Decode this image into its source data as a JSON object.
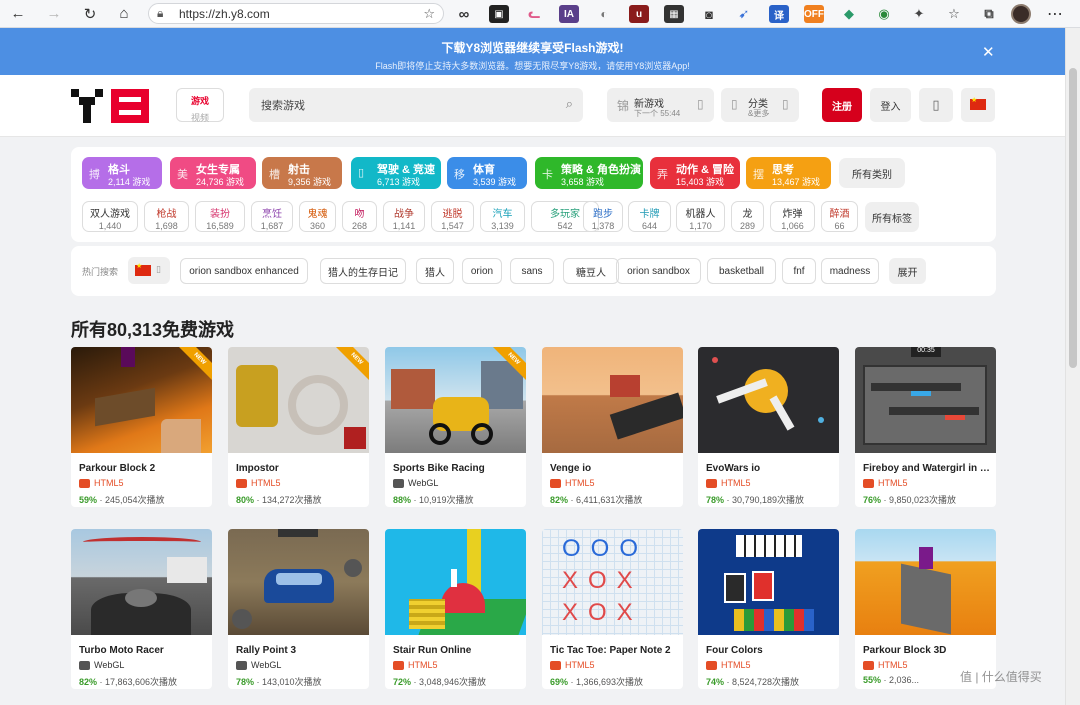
{
  "browser": {
    "url": "https://zh.y8.com"
  },
  "banner": {
    "title": "下载Y8浏览器继续享受Flash游戏!",
    "subtitle": "Flash即将停止支持大多数浏览器。想要无限尽享Y8游戏，请使用Y8浏览器App!"
  },
  "header": {
    "tab_games": "游戏",
    "tab_videos": "视频",
    "search_placeholder": "搜索游戏",
    "new_games": "新游戏",
    "new_games_sub": "下一个 55:44",
    "categories": "分类",
    "categories_sub": "&更多",
    "register": "注册",
    "login": "登入"
  },
  "categories": [
    {
      "name": "格斗",
      "count": "2,114 游戏",
      "icon": "搏",
      "color": "#b56ee8"
    },
    {
      "name": "女生专属",
      "count": "24,736 游戏",
      "icon": "美",
      "color": "#f04b84"
    },
    {
      "name": "射击",
      "count": "9,356 游戏",
      "icon": "槽",
      "color": "#c8784a"
    },
    {
      "name": "驾驶 & 竞速",
      "count": "6,713 游戏",
      "icon": "▯",
      "color": "#12b8c8"
    },
    {
      "name": "体育",
      "count": "3,539 游戏",
      "icon": "移",
      "color": "#3b8de8"
    },
    {
      "name": "策略 & 角色扮演",
      "count": "3,658 游戏",
      "icon": "卡",
      "color": "#2fb82a"
    },
    {
      "name": "动作 & 冒险",
      "count": "15,403 游戏",
      "icon": "弄",
      "color": "#e8303c"
    },
    {
      "name": "思考",
      "count": "13,467 游戏",
      "icon": "摆",
      "color": "#f5a012"
    }
  ],
  "all_categories": "所有类别",
  "tags": [
    {
      "name": "双人游戏",
      "count": "1,440",
      "color": "#333333"
    },
    {
      "name": "枪战",
      "count": "1,698",
      "color": "#c0392b"
    },
    {
      "name": "装扮",
      "count": "16,589",
      "color": "#d6336c"
    },
    {
      "name": "烹饪",
      "count": "1,687",
      "color": "#8e44ad"
    },
    {
      "name": "鬼魂",
      "count": "360",
      "color": "#d35400"
    },
    {
      "name": "吻",
      "count": "268",
      "color": "#c2185b"
    },
    {
      "name": "战争",
      "count": "1,141",
      "color": "#b03a2e"
    },
    {
      "name": "逃脱",
      "count": "1,547",
      "color": "#c0392b"
    },
    {
      "name": "汽车",
      "count": "3,139",
      "color": "#16a0b8"
    },
    {
      "name": "多玩家",
      "count": "542",
      "color": "#27a07a"
    },
    {
      "name": "跑步",
      "count": "1,378",
      "color": "#2d6fc7"
    },
    {
      "name": "卡牌",
      "count": "644",
      "color": "#1f9ab5"
    },
    {
      "name": "机器人",
      "count": "1,170",
      "color": "#333333"
    },
    {
      "name": "龙",
      "count": "289",
      "color": "#333333"
    },
    {
      "name": "炸弹",
      "count": "1,066",
      "color": "#333333"
    },
    {
      "name": "醉酒",
      "count": "66",
      "color": "#c0392b"
    }
  ],
  "all_tags": "所有标签",
  "hot": {
    "label": "热门搜索",
    "items": [
      "orion sandbox enhanced",
      "猎人的生存日记",
      "猎人",
      "orion",
      "sans",
      "糖豆人",
      "orion sandbox",
      "basketball",
      "fnf",
      "madness"
    ],
    "expand": "展开"
  },
  "section_title": "所有80,313免费游戏",
  "games": [
    {
      "name": "Parkour Block 2",
      "platform": "HTML5",
      "percent": "59%",
      "plays": "245,054次播放",
      "is_new": true
    },
    {
      "name": "Impostor",
      "platform": "HTML5",
      "percent": "80%",
      "plays": "134,272次播放",
      "is_new": true
    },
    {
      "name": "Sports Bike Racing",
      "platform": "WebGL",
      "percent": "88%",
      "plays": "10,919次播放",
      "is_new": true
    },
    {
      "name": "Venge io",
      "platform": "HTML5",
      "percent": "82%",
      "plays": "6,411,631次播放",
      "is_new": false
    },
    {
      "name": "EvoWars io",
      "platform": "HTML5",
      "percent": "78%",
      "plays": "30,790,189次播放",
      "is_new": false
    },
    {
      "name": "Fireboy and Watergirl in t...",
      "platform": "HTML5",
      "percent": "76%",
      "plays": "9,850,023次播放",
      "is_new": false
    },
    {
      "name": "Turbo Moto Racer",
      "platform": "WebGL",
      "percent": "82%",
      "plays": "17,863,606次播放",
      "is_new": false
    },
    {
      "name": "Rally Point 3",
      "platform": "WebGL",
      "percent": "78%",
      "plays": "143,010次播放",
      "is_new": false
    },
    {
      "name": "Stair Run Online",
      "platform": "HTML5",
      "percent": "72%",
      "plays": "3,048,946次播放",
      "is_new": false
    },
    {
      "name": "Tic Tac Toe: Paper Note 2",
      "platform": "HTML5",
      "percent": "69%",
      "plays": "1,366,693次播放",
      "is_new": false
    },
    {
      "name": "Four Colors",
      "platform": "HTML5",
      "percent": "74%",
      "plays": "8,524,728次播放",
      "is_new": false
    },
    {
      "name": "Parkour Block 3D",
      "platform": "HTML5",
      "percent": "55%",
      "plays": "2,036...",
      "is_new": false
    }
  ],
  "new_badge": "NEW",
  "watermark": "值 | 什么值得买"
}
